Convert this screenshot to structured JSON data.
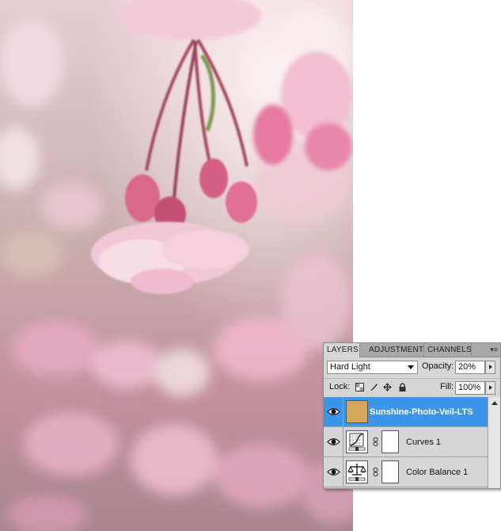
{
  "panel": {
    "tabs": [
      {
        "label": "LAYERS",
        "active": true
      },
      {
        "label": "ADJUSTMENTS",
        "active": false
      },
      {
        "label": "CHANNELS",
        "active": false
      }
    ],
    "blend_mode": "Hard Light",
    "opacity_label": "Opacity:",
    "opacity_value": "20%",
    "lock_label": "Lock:",
    "fill_label": "Fill:",
    "fill_value": "100%",
    "layers": [
      {
        "name": "Sunshine-Photo-Veil-LTS",
        "selected": true,
        "type": "fill",
        "thumb_color": "#d4a85c"
      },
      {
        "name": "Curves 1",
        "selected": false,
        "type": "curves-adjustment"
      },
      {
        "name": "Color Balance 1",
        "selected": false,
        "type": "color-balance-adjustment"
      }
    ],
    "selection_color": "#3d95ea"
  }
}
